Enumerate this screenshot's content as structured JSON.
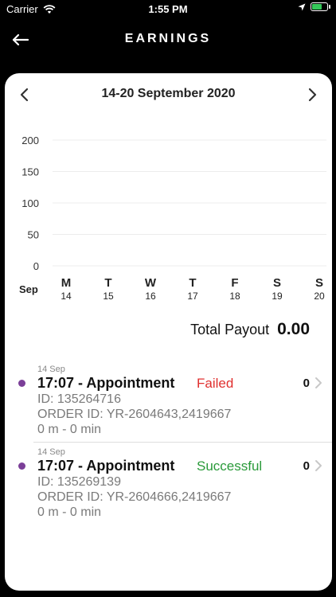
{
  "status_bar": {
    "carrier": "Carrier",
    "time": "1:55 PM"
  },
  "header": {
    "title": "EARNINGS"
  },
  "week_nav": {
    "label": "14-20 September 2020"
  },
  "chart_data": {
    "type": "bar",
    "month_label": "Sep",
    "categories": [
      "M",
      "T",
      "W",
      "T",
      "F",
      "S",
      "S"
    ],
    "dates": [
      "14",
      "15",
      "16",
      "17",
      "18",
      "19",
      "20"
    ],
    "values": [
      0,
      0,
      0,
      0,
      0,
      0,
      0
    ],
    "ylim": [
      0,
      200
    ],
    "yticks": [
      0,
      50,
      100,
      150,
      200
    ],
    "grid": true,
    "title": "",
    "xlabel": "",
    "ylabel": ""
  },
  "payout": {
    "label": "Total Payout",
    "value": "0.00"
  },
  "transactions": [
    {
      "date": "14 Sep",
      "title": "17:07 - Appointment",
      "status": "Failed",
      "id_line": "ID: 135264716",
      "order_line": "ORDER ID: YR-2604643,2419667",
      "duration": "0 m - 0 min",
      "amount": "0"
    },
    {
      "date": "14 Sep",
      "title": "17:07 - Appointment",
      "status": "Successful",
      "id_line": "ID: 135269139",
      "order_line": "ORDER ID: YR-2604666,2419667",
      "duration": "0 m - 0 min",
      "amount": "0"
    }
  ],
  "colors": {
    "failed": "#e0302f",
    "successful": "#2a9a3a",
    "dot": "#7b3f98",
    "battery": "#35c759"
  }
}
